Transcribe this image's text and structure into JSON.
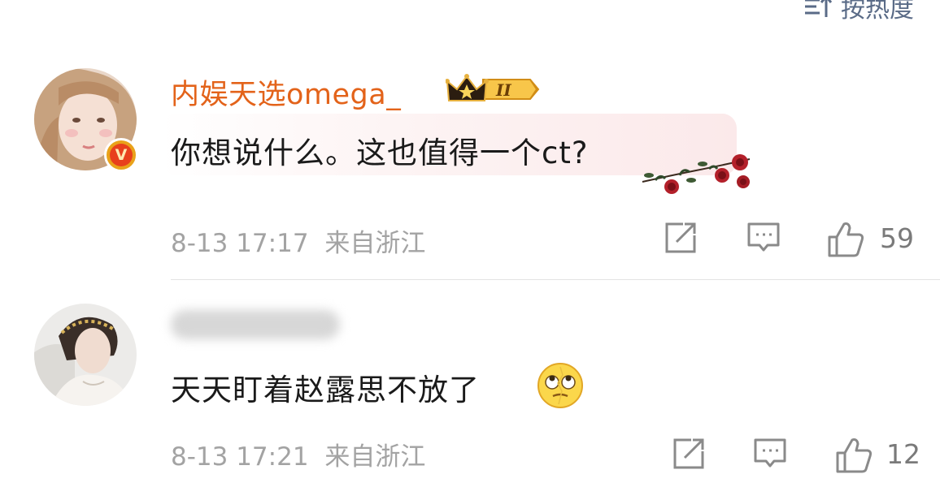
{
  "sort": {
    "label": "按热度",
    "icon": "sort-icon"
  },
  "comments": [
    {
      "username": "内娱天选omega_",
      "verified": true,
      "badge_level": "II",
      "text": "你想说什么。这也值得一个ct?",
      "time": "8-13 17:17",
      "location": "来自浙江",
      "likes": "59",
      "username_color": "#e3631a"
    },
    {
      "username_blurred": true,
      "text": "天天盯着赵露思不放了",
      "time": "8-13 17:21",
      "location": "来自浙江",
      "likes": "12",
      "emoji": "rolling-eyes-emoji"
    }
  ],
  "colors": {
    "meta": "#a3a3a3",
    "accent": "#e3631a",
    "icon": "#8a8a8a"
  }
}
